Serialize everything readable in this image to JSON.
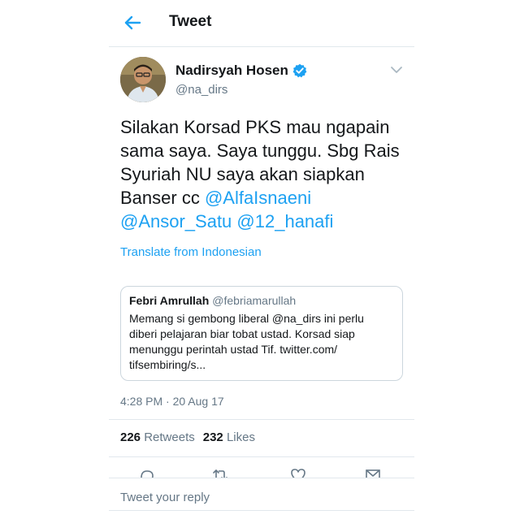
{
  "header": {
    "title": "Tweet",
    "back_icon": "arrow-left-icon",
    "accent_color": "#1da1f2"
  },
  "author": {
    "name": "Nadirsyah Hosen",
    "handle": "@na_dirs",
    "verified_icon": "verified-badge-icon",
    "menu_icon": "chevron-down-icon"
  },
  "tweet": {
    "text_parts": {
      "plain": "Silakan Korsad PKS mau ngapain sama saya. Saya tunggu. Sbg Rais Syuriah NU saya akan siapkan Banser cc ",
      "mention_1": "@AlfaIsnaeni",
      "mention_2": "@Ansor_Satu",
      "mention_3": "@12_hanafi"
    },
    "translate_label": "Translate from Indonesian",
    "timestamp": "4:28 PM · 20 Aug 17"
  },
  "quoted": {
    "name": "Febri Amrullah",
    "handle": "@febriamarullah",
    "text": "Memang si gembong  liberal @na_dirs ini perlu diberi pelajaran biar tobat ustad.  Korsad siap menunggu perintah ustad Tif. twitter.com/ tifsembiring/s..."
  },
  "stats": {
    "retweets_count": "226",
    "retweets_label": "Retweets",
    "likes_count": "232",
    "likes_label": "Likes"
  },
  "actions": {
    "icons": [
      "reply-icon",
      "retweet-icon",
      "like-icon",
      "share-icon"
    ]
  },
  "reply": {
    "placeholder": "Tweet your reply"
  }
}
